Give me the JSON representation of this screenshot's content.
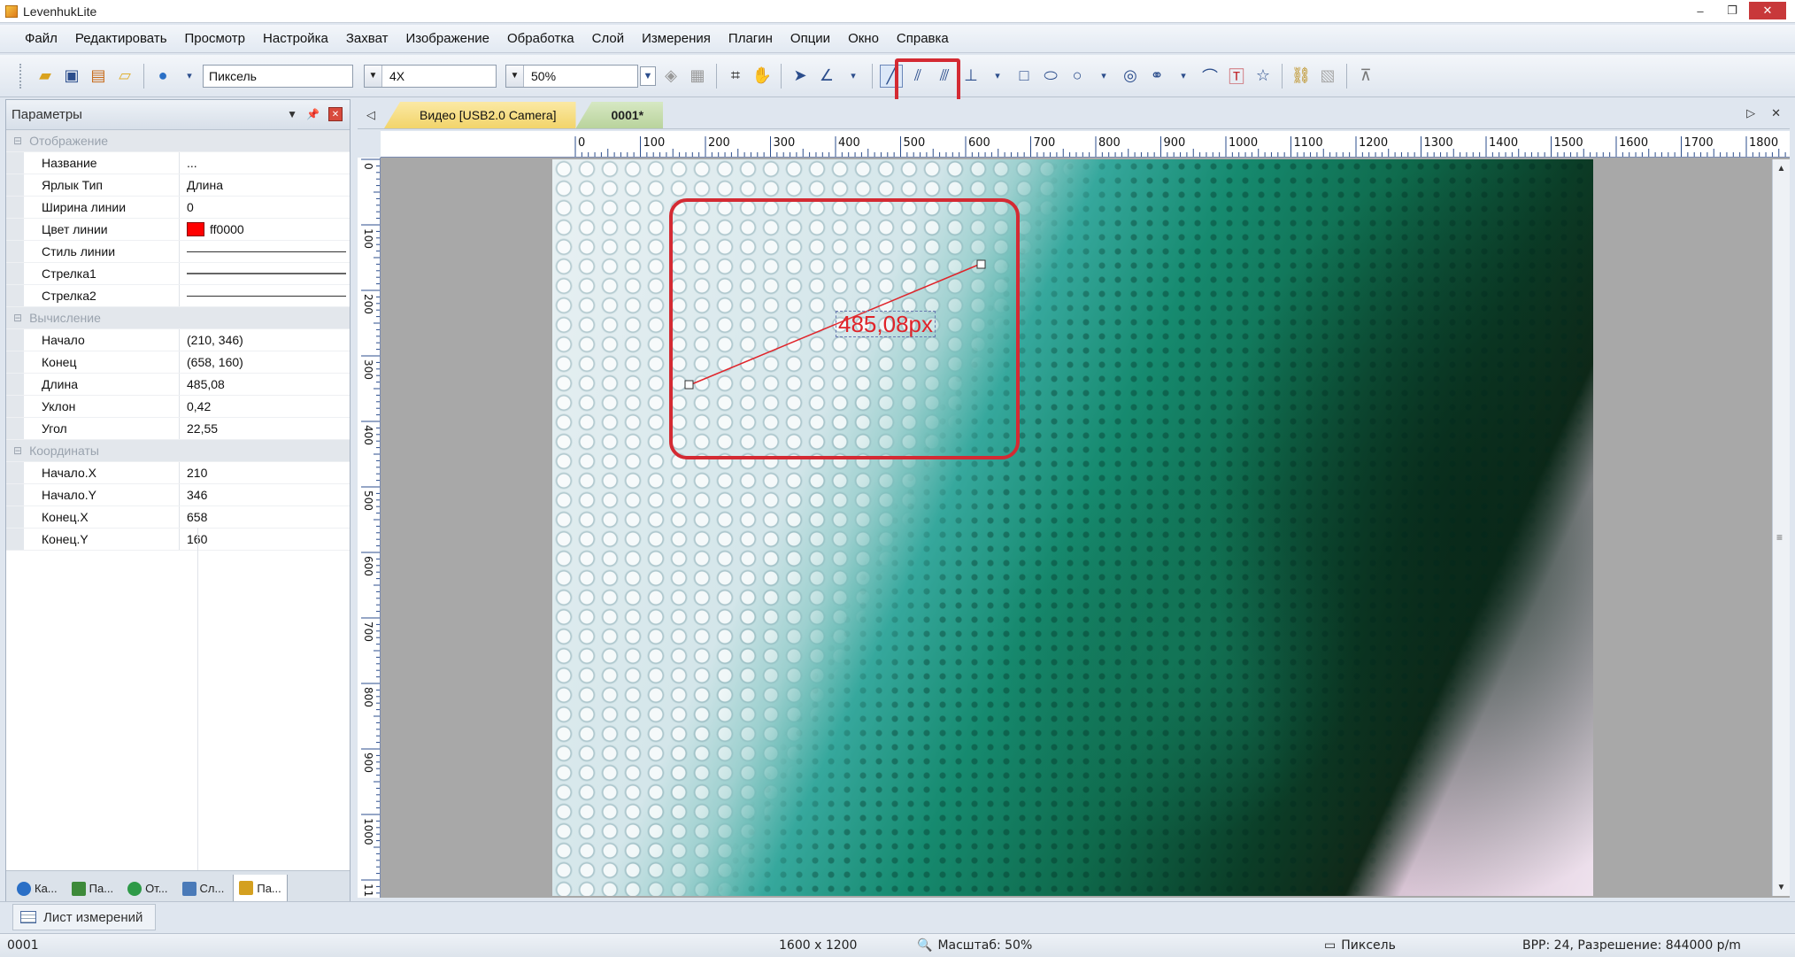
{
  "window": {
    "title": "LevenhukLite",
    "minimize": "–",
    "maximize": "❐",
    "close": "✕"
  },
  "menu": [
    "Файл",
    "Редактировать",
    "Просмотр",
    "Настройка",
    "Захват",
    "Изображение",
    "Обработка",
    "Слой",
    "Измерения",
    "Плагин",
    "Опции",
    "Окно",
    "Справка"
  ],
  "toolbar": {
    "unit": "Пиксель",
    "objective": "4X",
    "zoom": "50%"
  },
  "panel": {
    "title": "Параметры",
    "sections": [
      {
        "name": "Отображение",
        "rows": [
          {
            "key": "Название",
            "value": "..."
          },
          {
            "key": "Ярлык Тип",
            "value": "Длина"
          },
          {
            "key": "Ширина линии",
            "value": "0"
          },
          {
            "key": "Цвет линии",
            "value": "ff0000"
          },
          {
            "key": "Стиль линии",
            "value": ""
          },
          {
            "key": "Стрелка1",
            "value": ""
          },
          {
            "key": "Стрелка2",
            "value": ""
          }
        ]
      },
      {
        "name": "Вычисление",
        "rows": [
          {
            "key": "Начало",
            "value": "(210, 346)"
          },
          {
            "key": "Конец",
            "value": "(658, 160)"
          },
          {
            "key": "Длина",
            "value": "485,08"
          },
          {
            "key": "Уклон",
            "value": "0,42"
          },
          {
            "key": "Угол",
            "value": "22,55"
          }
        ]
      },
      {
        "name": "Координаты",
        "rows": [
          {
            "key": "Начало.X",
            "value": "210"
          },
          {
            "key": "Начало.Y",
            "value": "346"
          },
          {
            "key": "Конец.X",
            "value": "658"
          },
          {
            "key": "Конец.Y",
            "value": "160"
          }
        ]
      }
    ],
    "tabs": [
      "Ка...",
      "Па...",
      "От...",
      "Сл...",
      "Па..."
    ]
  },
  "doc_tabs": [
    "Видео [USB2.0 Camera]",
    "0001*"
  ],
  "ruler": {
    "top": [
      "0",
      "100",
      "200",
      "300",
      "400",
      "500",
      "600",
      "700",
      "800",
      "900",
      "1000",
      "1100",
      "1200",
      "1300",
      "1400",
      "1500",
      "1600",
      "1700",
      "1800"
    ],
    "left": [
      "0",
      "100",
      "200",
      "300",
      "400",
      "500",
      "600",
      "700",
      "800",
      "900",
      "1000",
      "11"
    ]
  },
  "measurement": {
    "label": "485,08px",
    "start": [
      210,
      346
    ],
    "end": [
      658,
      160
    ]
  },
  "sheet_tab": "Лист измерений",
  "status": {
    "name": "0001",
    "size": "1600 x 1200",
    "scale": "Масштаб: 50%",
    "unit": "Пиксель",
    "info": "BPP: 24, Разрешение: 844000 p/m"
  },
  "colors": {
    "highlight": "#d42a33",
    "measure": "#e0242a"
  }
}
